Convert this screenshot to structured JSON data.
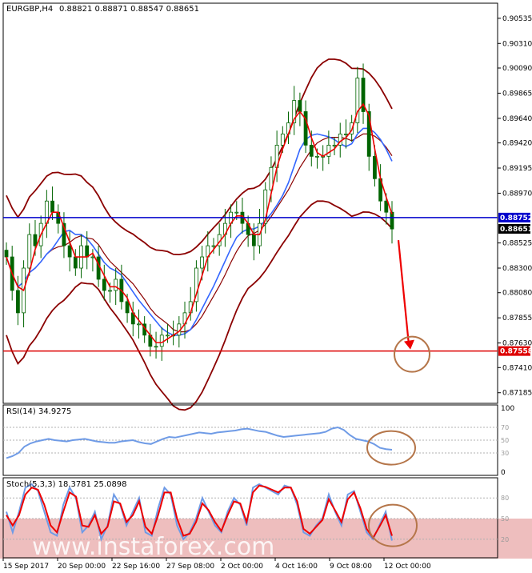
{
  "chart_data": {
    "type": "candlestick",
    "instrument_label": "EURGBP,H4",
    "ohlc_label": "0.88821 0.88871 0.88547 0.88651",
    "price_axis": {
      "ticks": [
        "0.90535",
        "0.90310",
        "0.90090",
        "0.89865",
        "0.89640",
        "0.89420",
        "0.89195",
        "0.88970",
        "0.88525",
        "0.88300",
        "0.88080",
        "0.87855",
        "0.87630",
        "0.87410",
        "0.87185"
      ],
      "ylim": [
        0.8709,
        0.9067
      ]
    },
    "x_labels": [
      "15 Sep 2017",
      "20 Sep 00:00",
      "22 Sep 16:00",
      "27 Sep 08:00",
      "2 Oct 00:00",
      "4 Oct 16:00",
      "9 Oct 08:00",
      "12 Oct 00:00"
    ],
    "price_levels": [
      {
        "name": "resistance",
        "value": 0.88752,
        "label": "0.88752",
        "color": "#0000cc"
      },
      {
        "name": "current",
        "value": 0.88651,
        "label": "0.88651",
        "color": "#000000"
      },
      {
        "name": "target",
        "value": 0.87558,
        "label": "0.87558",
        "color": "#dd0000"
      }
    ],
    "close_path": [
      0.884,
      0.881,
      0.879,
      0.883,
      0.886,
      0.885,
      0.887,
      0.889,
      0.888,
      0.887,
      0.885,
      0.884,
      0.883,
      0.885,
      0.884,
      0.884,
      0.882,
      0.881,
      0.881,
      0.882,
      0.88,
      0.879,
      0.878,
      0.878,
      0.877,
      0.876,
      0.876,
      0.877,
      0.877,
      0.877,
      0.878,
      0.879,
      0.88,
      0.883,
      0.884,
      0.885,
      0.885,
      0.886,
      0.887,
      0.888,
      0.888,
      0.887,
      0.886,
      0.885,
      0.887,
      0.89,
      0.892,
      0.894,
      0.895,
      0.896,
      0.898,
      0.897,
      0.894,
      0.893,
      0.893,
      0.893,
      0.894,
      0.894,
      0.895,
      0.895,
      0.896,
      0.9,
      0.897,
      0.893,
      0.891,
      0.889,
      0.888,
      0.8865
    ],
    "overlays": [
      "Bollinger Bands",
      "Moving Average",
      "Moving Average"
    ],
    "rsi": {
      "label": "RSI(14) 34.9275",
      "levels": [
        "100",
        "70",
        "50",
        "30",
        "0"
      ],
      "values": [
        22,
        25,
        30,
        40,
        45,
        48,
        50,
        52,
        50,
        49,
        48,
        50,
        51,
        52,
        50,
        48,
        47,
        46,
        46,
        48,
        49,
        50,
        47,
        45,
        44,
        48,
        52,
        55,
        54,
        56,
        58,
        60,
        62,
        61,
        60,
        62,
        63,
        64,
        65,
        67,
        68,
        66,
        64,
        63,
        60,
        57,
        55,
        56,
        57,
        58,
        59,
        60,
        61,
        63,
        68,
        70,
        66,
        58,
        52,
        50,
        48,
        44,
        38,
        36,
        35
      ]
    },
    "stoch": {
      "label": "Stoch(5,3,3) 18.3781 25.0898",
      "levels": [
        "80",
        "50",
        "20"
      ],
      "main": [
        60,
        30,
        60,
        95,
        100,
        90,
        60,
        30,
        25,
        70,
        95,
        80,
        30,
        40,
        60,
        20,
        40,
        85,
        70,
        40,
        60,
        80,
        30,
        25,
        65,
        95,
        85,
        40,
        20,
        30,
        50,
        80,
        60,
        40,
        30,
        60,
        80,
        70,
        40,
        95,
        100,
        95,
        90,
        85,
        98,
        95,
        70,
        30,
        25,
        40,
        50,
        85,
        60,
        40,
        85,
        90,
        60,
        30,
        20,
        40,
        60,
        18
      ],
      "signal": [
        55,
        40,
        55,
        85,
        95,
        92,
        70,
        40,
        30,
        60,
        88,
        82,
        40,
        38,
        55,
        28,
        38,
        75,
        72,
        45,
        55,
        75,
        38,
        28,
        55,
        88,
        88,
        50,
        25,
        28,
        45,
        72,
        62,
        45,
        32,
        55,
        75,
        72,
        45,
        88,
        98,
        96,
        92,
        88,
        95,
        95,
        75,
        35,
        28,
        38,
        48,
        78,
        62,
        45,
        78,
        88,
        65,
        35,
        22,
        38,
        55,
        25
      ]
    }
  },
  "watermark": "www.instaforex.com",
  "colors": {
    "bollinger": "#8b0000",
    "ma_fast": "#ee0000",
    "ma_slow": "#3366ff",
    "candle": "#006400",
    "rsi_line": "#6f9be6",
    "stoch_main": "#6f9be6",
    "stoch_signal": "#ee0000",
    "projection_arrow": "#ee0000",
    "circle": "#b5764a"
  }
}
